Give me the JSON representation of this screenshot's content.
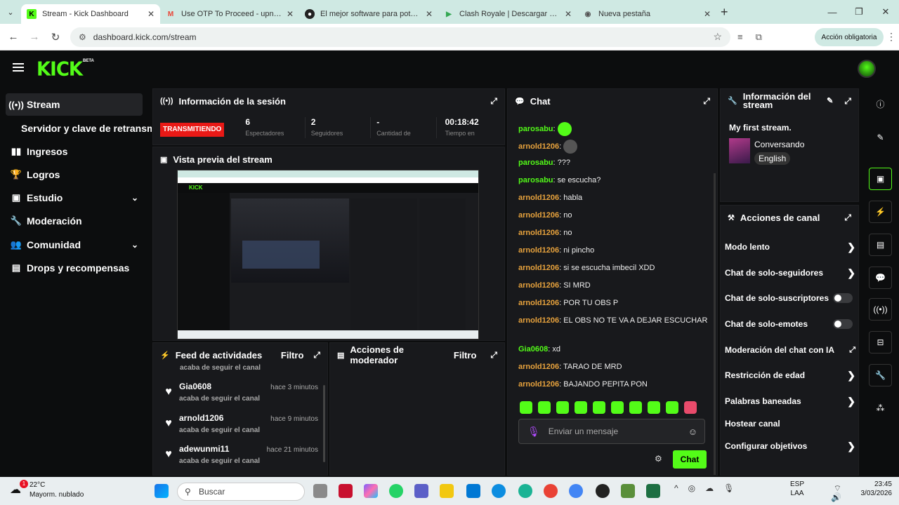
{
  "browser": {
    "tabs": [
      {
        "label": "Stream - Kick Dashboard",
        "icon": "kick-icon",
        "active": true
      },
      {
        "label": "Use OTP To Proceed - upn.aci@",
        "icon": "gmail-icon",
        "active": false
      },
      {
        "label": "El mejor software para potencia",
        "icon": "obs-icon",
        "active": false
      },
      {
        "label": "Clash Royale | Descargar y juga",
        "icon": "play-store-icon",
        "active": false
      },
      {
        "label": "Nueva pestaña",
        "icon": "chrome-icon",
        "active": false
      }
    ],
    "url": "dashboard.kick.com/stream",
    "action_button": "Acción obligatoria"
  },
  "app": {
    "logo": "KICK",
    "beta": "BETA"
  },
  "sidebar": {
    "items": [
      {
        "label": "Stream",
        "icon": "stream-icon",
        "active": true
      },
      {
        "label": "Servidor y clave de retransm",
        "icon": "",
        "active": false
      },
      {
        "label": "Ingresos",
        "icon": "chart-icon",
        "active": false
      },
      {
        "label": "Logros",
        "icon": "trophy-icon",
        "active": false
      },
      {
        "label": "Estudio",
        "icon": "studio-icon",
        "active": false,
        "expandable": true
      },
      {
        "label": "Moderación",
        "icon": "wrench-icon",
        "active": false
      },
      {
        "label": "Comunidad",
        "icon": "people-icon",
        "active": false,
        "expandable": true
      },
      {
        "label": "Drops y recompensas",
        "icon": "gift-icon",
        "active": false
      }
    ]
  },
  "session": {
    "title": "Información de la sesión",
    "status": "TRANSMITIENDO",
    "stats": [
      {
        "value": "6",
        "label": "Espectadores"
      },
      {
        "value": "2",
        "label": "Seguidores"
      },
      {
        "value": "-",
        "label": "Cantidad de"
      },
      {
        "value": "00:18:42",
        "label": "Tiempo en"
      }
    ]
  },
  "preview": {
    "title": "Vista previa del stream"
  },
  "feed": {
    "title": "Feed de actividades",
    "filter": "Filtro",
    "partial": "acaba de seguir el canal",
    "items": [
      {
        "user": "Gia0608",
        "time": "hace 3 minutos",
        "text": "acaba de seguir el canal"
      },
      {
        "user": "arnold1206",
        "time": "hace 9 minutos",
        "text": "acaba de seguir el canal"
      },
      {
        "user": "adewunmi11",
        "time": "hace 21 minutos",
        "text": "acaba de seguir el canal"
      }
    ]
  },
  "modactions": {
    "title": "Acciones de moderador",
    "filter": "Filtro"
  },
  "chat": {
    "title": "Chat",
    "messages": [
      {
        "user": "parosabu",
        "text": "",
        "color": "#53fc18",
        "emote": true
      },
      {
        "user": "arnold1206",
        "text": "",
        "color": "#e8a33d",
        "emote": true
      },
      {
        "user": "parosabu",
        "text": "???",
        "color": "#53fc18"
      },
      {
        "user": "parosabu",
        "text": "se escucha?",
        "color": "#53fc18"
      },
      {
        "user": "arnold1206",
        "text": "habla",
        "color": "#e8a33d"
      },
      {
        "user": "arnold1206",
        "text": "no",
        "color": "#e8a33d"
      },
      {
        "user": "arnold1206",
        "text": "no",
        "color": "#e8a33d"
      },
      {
        "user": "arnold1206",
        "text": "ni pincho",
        "color": "#e8a33d"
      },
      {
        "user": "arnold1206",
        "text": "si se escucha imbecil XDD",
        "color": "#e8a33d"
      },
      {
        "user": "arnold1206",
        "text": "SI MRD",
        "color": "#e8a33d"
      },
      {
        "user": "arnold1206",
        "text": "POR TU OBS P",
        "color": "#e8a33d"
      },
      {
        "user": "arnold1206",
        "text": "EL OBS NO TE VA A DEJAR ESCUCHAR",
        "color": "#e8a33d"
      },
      {
        "user": "Gia0608",
        "text": "xd",
        "color": "#53fc18"
      },
      {
        "user": "arnold1206",
        "text": "TARAO DE MRD",
        "color": "#e8a33d"
      },
      {
        "user": "arnold1206",
        "text": "BAJANDO PEPITA PON",
        "color": "#e8a33d"
      }
    ],
    "input_placeholder": "Enviar un mensaje",
    "send_label": "Chat"
  },
  "streaminfo": {
    "title": "Información del stream",
    "stream_title": "My first stream.",
    "category": "Conversando",
    "language": "English"
  },
  "channel_actions": {
    "title": "Acciones de canal",
    "items": [
      {
        "label": "Modo lento",
        "control": "arrow"
      },
      {
        "label": "Chat de solo-seguidores",
        "control": "arrow"
      },
      {
        "label": "Chat de solo-suscriptores",
        "control": "toggle"
      },
      {
        "label": "Chat de solo-emotes",
        "control": "toggle"
      },
      {
        "label": "Moderación del chat con IA",
        "control": "external"
      },
      {
        "label": "Restricción de edad",
        "control": "arrow"
      },
      {
        "label": "Palabras baneadas",
        "control": "arrow"
      },
      {
        "label": "Hostear canal",
        "control": "none"
      },
      {
        "label": "Configurar objetivos",
        "control": "arrow"
      }
    ]
  },
  "taskbar": {
    "weather_temp": "22°C",
    "weather_desc": "Mayorm. nublado",
    "weather_badge": "1",
    "search": "Buscar",
    "lang1": "ESP",
    "lang2": "LAA",
    "time": "23:45",
    "date": "3/03/2026"
  }
}
